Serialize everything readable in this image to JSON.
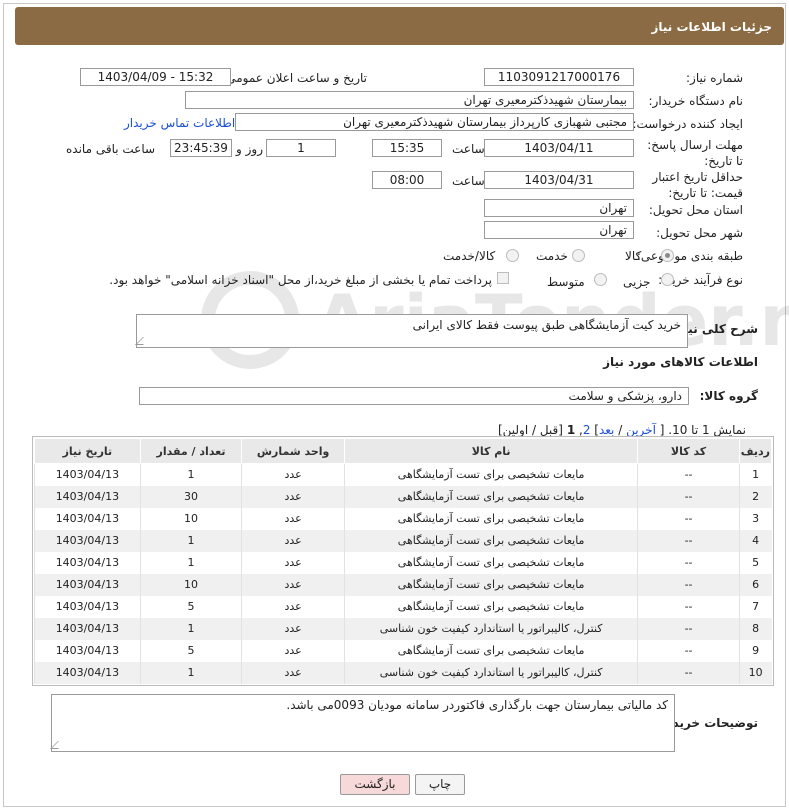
{
  "header": {
    "title": "جزئیات اطلاعات نیاز"
  },
  "form": {
    "need_number_label": "شماره نیاز:",
    "need_number": "1103091217000176",
    "announce_label": "تاریخ و ساعت اعلان عمومی:",
    "announce_value": "1403/04/09 - 15:32",
    "buyer_org_label": "نام دستگاه خریدار:",
    "buyer_org": "بیمارستان شهیدذکترمعیری تهران",
    "creator_label": "ایجاد کننده درخواست:",
    "creator": "مجتبی  شهبازی کارپرداز بیمارستان شهیدذکترمعیری تهران",
    "contact_link": "اطلاعات تماس خریدار",
    "reply_deadline_label": "مهلت ارسال پاسخ: تا تاریخ:",
    "reply_date": "1403/04/11",
    "time_label": "ساعت",
    "reply_time": "15:35",
    "days": "1",
    "days_label": "روز و",
    "remaining": "23:45:39",
    "remaining_label": "ساعت باقی مانده",
    "price_deadline_label": "حداقل تاریخ اعتبار قیمت: تا تاریخ:",
    "price_date": "1403/04/31",
    "price_time": "08:00",
    "province_label": "استان محل تحویل:",
    "province": "تهران",
    "city_label": "شهر محل تحویل:",
    "city": "تهران",
    "category_label": "طبقه بندی موضوعی:",
    "category_options": [
      "کالا",
      "خدمت",
      "کالا/خدمت"
    ],
    "process_label": "نوع فرآیند خرید :",
    "process_options": [
      "جزیی",
      "متوسط"
    ],
    "treasury_note": "پرداخت تمام یا بخشی از مبلغ خرید،از محل \"اسناد خزانه اسلامی\" خواهد بود."
  },
  "description": {
    "label": "شرح کلی نیاز:",
    "text": "خرید کیت آزمایشگاهی طبق پیوست فقط کالای ایرانی"
  },
  "goods_section": {
    "title": "اطلاعات کالاهای مورد نیاز"
  },
  "goods_group": {
    "label": "گروه کالا:",
    "value": "دارو، پزشکی و سلامت"
  },
  "pagination": {
    "prefix": "نمایش 1 تا 10. [",
    "last": "آخرین",
    "next": "بعد",
    "page2": "2",
    "current": "1",
    "suffix": "[قبل / اولین]"
  },
  "table": {
    "headers": [
      "ردیف",
      "کد کالا",
      "نام کالا",
      "واحد شمارش",
      "تعداد / مقدار",
      "تاریخ نیاز"
    ],
    "rows": [
      [
        "1",
        "--",
        "مایعات تشخیصی برای تست آزمایشگاهی",
        "عدد",
        "1",
        "1403/04/13"
      ],
      [
        "2",
        "--",
        "مایعات تشخیصی برای تست آزمایشگاهی",
        "عدد",
        "30",
        "1403/04/13"
      ],
      [
        "3",
        "--",
        "مایعات تشخیصی برای تست آزمایشگاهی",
        "عدد",
        "10",
        "1403/04/13"
      ],
      [
        "4",
        "--",
        "مایعات تشخیصی برای تست آزمایشگاهی",
        "عدد",
        "1",
        "1403/04/13"
      ],
      [
        "5",
        "--",
        "مایعات تشخیصی برای تست آزمایشگاهی",
        "عدد",
        "1",
        "1403/04/13"
      ],
      [
        "6",
        "--",
        "مایعات تشخیصی برای تست آزمایشگاهی",
        "عدد",
        "10",
        "1403/04/13"
      ],
      [
        "7",
        "--",
        "مایعات تشخیصی برای تست آزمایشگاهی",
        "عدد",
        "5",
        "1403/04/13"
      ],
      [
        "8",
        "--",
        "کنترل، کالیبراتور یا استاندارد کیفیت خون شناسی",
        "عدد",
        "1",
        "1403/04/13"
      ],
      [
        "9",
        "--",
        "مایعات تشخیصی برای تست آزمایشگاهی",
        "عدد",
        "5",
        "1403/04/13"
      ],
      [
        "10",
        "--",
        "کنترل، کالیبراتور یا استاندارد کیفیت خون شناسی",
        "عدد",
        "1",
        "1403/04/13"
      ]
    ]
  },
  "buyer_notes": {
    "label": "توضیحات خریدار:",
    "text": "کد مالیاتی بیمارستان جهت بارگذاری فاکتوردر سامانه مودیان 0093می باشد."
  },
  "buttons": {
    "print": "چاپ",
    "back": "بازگشت"
  },
  "watermark": {
    "text": "AriaTender.neT"
  },
  "colors": {
    "header_bg": "#8b6b43",
    "link": "#1a4fd6",
    "back_button_bg": "#f7d9d9"
  }
}
